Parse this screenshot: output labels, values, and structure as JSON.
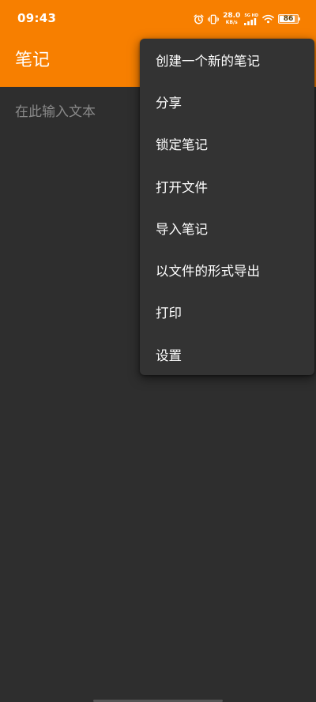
{
  "status_bar": {
    "time": "09:43",
    "net_speed_value": "28.0",
    "net_speed_unit": "KB/s",
    "signal_label": "5G HD",
    "battery": "86",
    "battery_level_percent": 86
  },
  "app_bar": {
    "title": "笔记",
    "color": "#f77f00"
  },
  "editor": {
    "placeholder": "在此输入文本"
  },
  "overflow_menu": {
    "items": [
      {
        "label": "创建一个新的笔记"
      },
      {
        "label": "分享"
      },
      {
        "label": "锁定笔记"
      },
      {
        "label": "打开文件"
      },
      {
        "label": "导入笔记"
      },
      {
        "label": "以文件的形式导出"
      },
      {
        "label": "打印"
      },
      {
        "label": "设置"
      }
    ]
  },
  "icons": {
    "alarm": "alarm-icon",
    "vibrate": "vibrate-icon",
    "signal": "signal-icon",
    "wifi": "wifi-icon",
    "battery": "battery-icon"
  }
}
